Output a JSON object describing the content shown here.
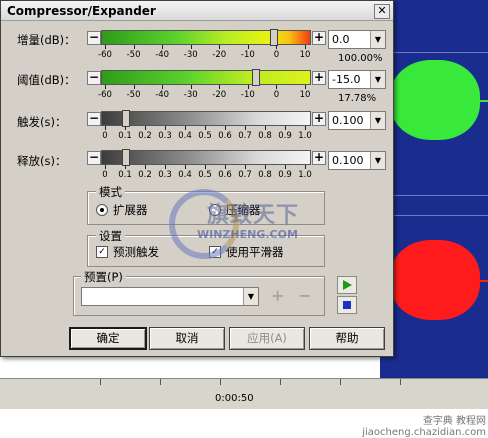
{
  "dialog": {
    "title": "Compressor/Expander",
    "close_label": "✕"
  },
  "rows": [
    {
      "label": "增量(dB)：",
      "value": "0.0",
      "percent": "100.00%",
      "thumb": 0.84
    },
    {
      "label": "阈值(dB)：",
      "value": "-15.0",
      "percent": "17.78%",
      "thumb": 0.75
    },
    {
      "label": "触发(s)：",
      "value": "0.100",
      "thumb": 0.1
    },
    {
      "label": "释放(s)：",
      "value": "0.100",
      "thumb": 0.1
    }
  ],
  "scales": {
    "db": [
      "-60",
      "-50",
      "-40",
      "-30",
      "-20",
      "-10",
      "0",
      "10"
    ],
    "sec": [
      "0",
      "0.1",
      "0.2",
      "0.3",
      "0.4",
      "0.5",
      "0.6",
      "0.7",
      "0.8",
      "0.9",
      "1.0"
    ]
  },
  "minus_label": "−",
  "plus_label": "+",
  "mode": {
    "title": "模式",
    "expander_label": "扩展器",
    "compressor_label": "压缩器"
  },
  "settings": {
    "title": "设置",
    "predict_label": "预测触发",
    "smoother_label": "使用平滑器"
  },
  "preset": {
    "title": "预置(P)",
    "add_label": "+",
    "remove_label": "−"
  },
  "buttons": {
    "ok": "确定",
    "cancel": "取消",
    "apply": "应用(A)",
    "help": "帮助"
  },
  "timeline": {
    "time": "0:00:50"
  },
  "watermark": {
    "cn": "旗致天下",
    "en": "WINZHENG.COM",
    "site": "查字典 教程网 jiaocheng.chazidian.com"
  },
  "colors": {
    "editor_bg": "#1a2d8f",
    "wave_green": "#38e83a",
    "wave_red": "#ff1b1b"
  }
}
